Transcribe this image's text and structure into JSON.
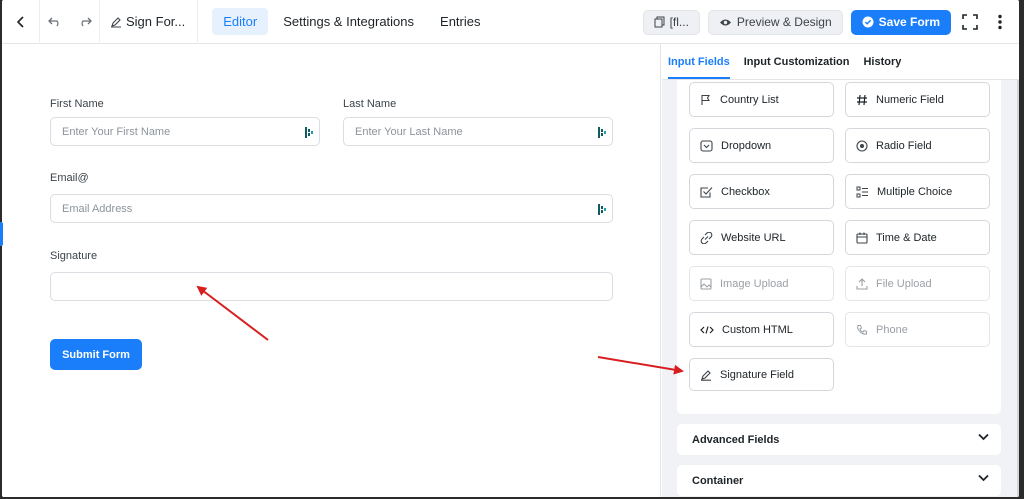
{
  "topbar": {
    "form_title": "Sign For...",
    "tabs": [
      {
        "label": "Editor",
        "active": true
      },
      {
        "label": "Settings & Integrations",
        "active": false
      },
      {
        "label": "Entries",
        "active": false
      }
    ],
    "shortcode_label": "[fl...",
    "preview_label": "Preview & Design",
    "save_label": "Save Form"
  },
  "form": {
    "first_name": {
      "label": "First Name",
      "placeholder": "Enter Your First Name"
    },
    "last_name": {
      "label": "Last Name",
      "placeholder": "Enter Your Last Name"
    },
    "email": {
      "label": "Email@",
      "placeholder": "Email Address"
    },
    "signature": {
      "label": "Signature",
      "value": ""
    },
    "submit_label": "Submit Form"
  },
  "panel": {
    "tabs": [
      {
        "label": "Input Fields",
        "active": true
      },
      {
        "label": "Input Customization",
        "active": false
      },
      {
        "label": "History",
        "active": false
      }
    ],
    "fields": [
      {
        "label": "Country List",
        "icon": "flag-icon",
        "enabled": true
      },
      {
        "label": "Numeric Field",
        "icon": "hash-icon",
        "enabled": true
      },
      {
        "label": "Dropdown",
        "icon": "dropdown-icon",
        "enabled": true
      },
      {
        "label": "Radio Field",
        "icon": "radio-icon",
        "enabled": true
      },
      {
        "label": "Checkbox",
        "icon": "checkbox-icon",
        "enabled": true
      },
      {
        "label": "Multiple Choice",
        "icon": "list-icon",
        "enabled": true
      },
      {
        "label": "Website URL",
        "icon": "link-icon",
        "enabled": true
      },
      {
        "label": "Time & Date",
        "icon": "calendar-icon",
        "enabled": true
      },
      {
        "label": "Image Upload",
        "icon": "image-icon",
        "enabled": false
      },
      {
        "label": "File Upload",
        "icon": "upload-icon",
        "enabled": false
      },
      {
        "label": "Custom HTML",
        "icon": "code-icon",
        "enabled": true
      },
      {
        "label": "Phone",
        "icon": "phone-icon",
        "enabled": false
      },
      {
        "label": "Signature Field",
        "icon": "pen-icon",
        "enabled": true
      }
    ],
    "sections": [
      {
        "label": "Advanced Fields"
      },
      {
        "label": "Container"
      }
    ]
  },
  "colors": {
    "accent": "#1a7efb",
    "arrow": "#d81f1f"
  }
}
